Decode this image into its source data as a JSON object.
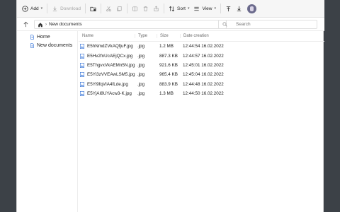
{
  "toolbar": {
    "add_label": "Add",
    "download_label": "Download",
    "sort_label": "Sort",
    "view_label": "View"
  },
  "address": {
    "path": "New documents"
  },
  "search": {
    "placeholder": "Search"
  },
  "sidebar": {
    "items": [
      {
        "label": "Home"
      },
      {
        "label": "New documents"
      }
    ]
  },
  "table": {
    "headers": {
      "name": "Name",
      "type": "Type",
      "size": "Size",
      "date": "Date creation"
    },
    "rows": [
      {
        "name": "E5hNmdZVkAQfjuF.jpg",
        "type": ".jpg",
        "size": "1.2 MB",
        "date": "12:44:54 16.02.2022"
      },
      {
        "name": "E5Hv2fnUcAEjQCx.jpg",
        "type": ".jpg",
        "size": "887.3 KB",
        "date": "12:44:57 16.02.2022"
      },
      {
        "name": "E5ThgvxVkAEMn5N.jpg",
        "type": ".jpg",
        "size": "921.6 KB",
        "date": "12:45:01 16.02.2022"
      },
      {
        "name": "E5Yi3zVVEAwLSM5.jpg",
        "type": ".jpg",
        "size": "965.4 KB",
        "date": "12:45:04 16.02.2022"
      },
      {
        "name": "E5Yi9fqVIA4fLde.jpg",
        "type": ".jpg",
        "size": "883.9 KB",
        "date": "12:44:48 16.02.2022"
      },
      {
        "name": "E5YjAI8UYAcw3-K.jpg",
        "type": ".jpg",
        "size": "1.3 MB",
        "date": "12:44:50 16.02.2022"
      }
    ]
  },
  "colors": {
    "accent": "#2f6fd6",
    "toolbar_bg": "#f6f6f6",
    "desktop_bg": "#3c4147"
  }
}
